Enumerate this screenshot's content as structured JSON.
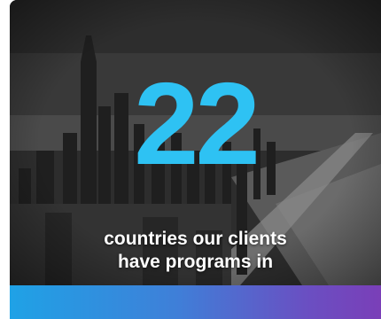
{
  "stat": {
    "number": "22",
    "caption_line1": "countries our clients",
    "caption_line2": "have programs in"
  },
  "colors": {
    "number": "#2ec2f3",
    "caption": "#ffffff",
    "bar_start": "#1fa2e6",
    "bar_end": "#7a3fb8"
  }
}
